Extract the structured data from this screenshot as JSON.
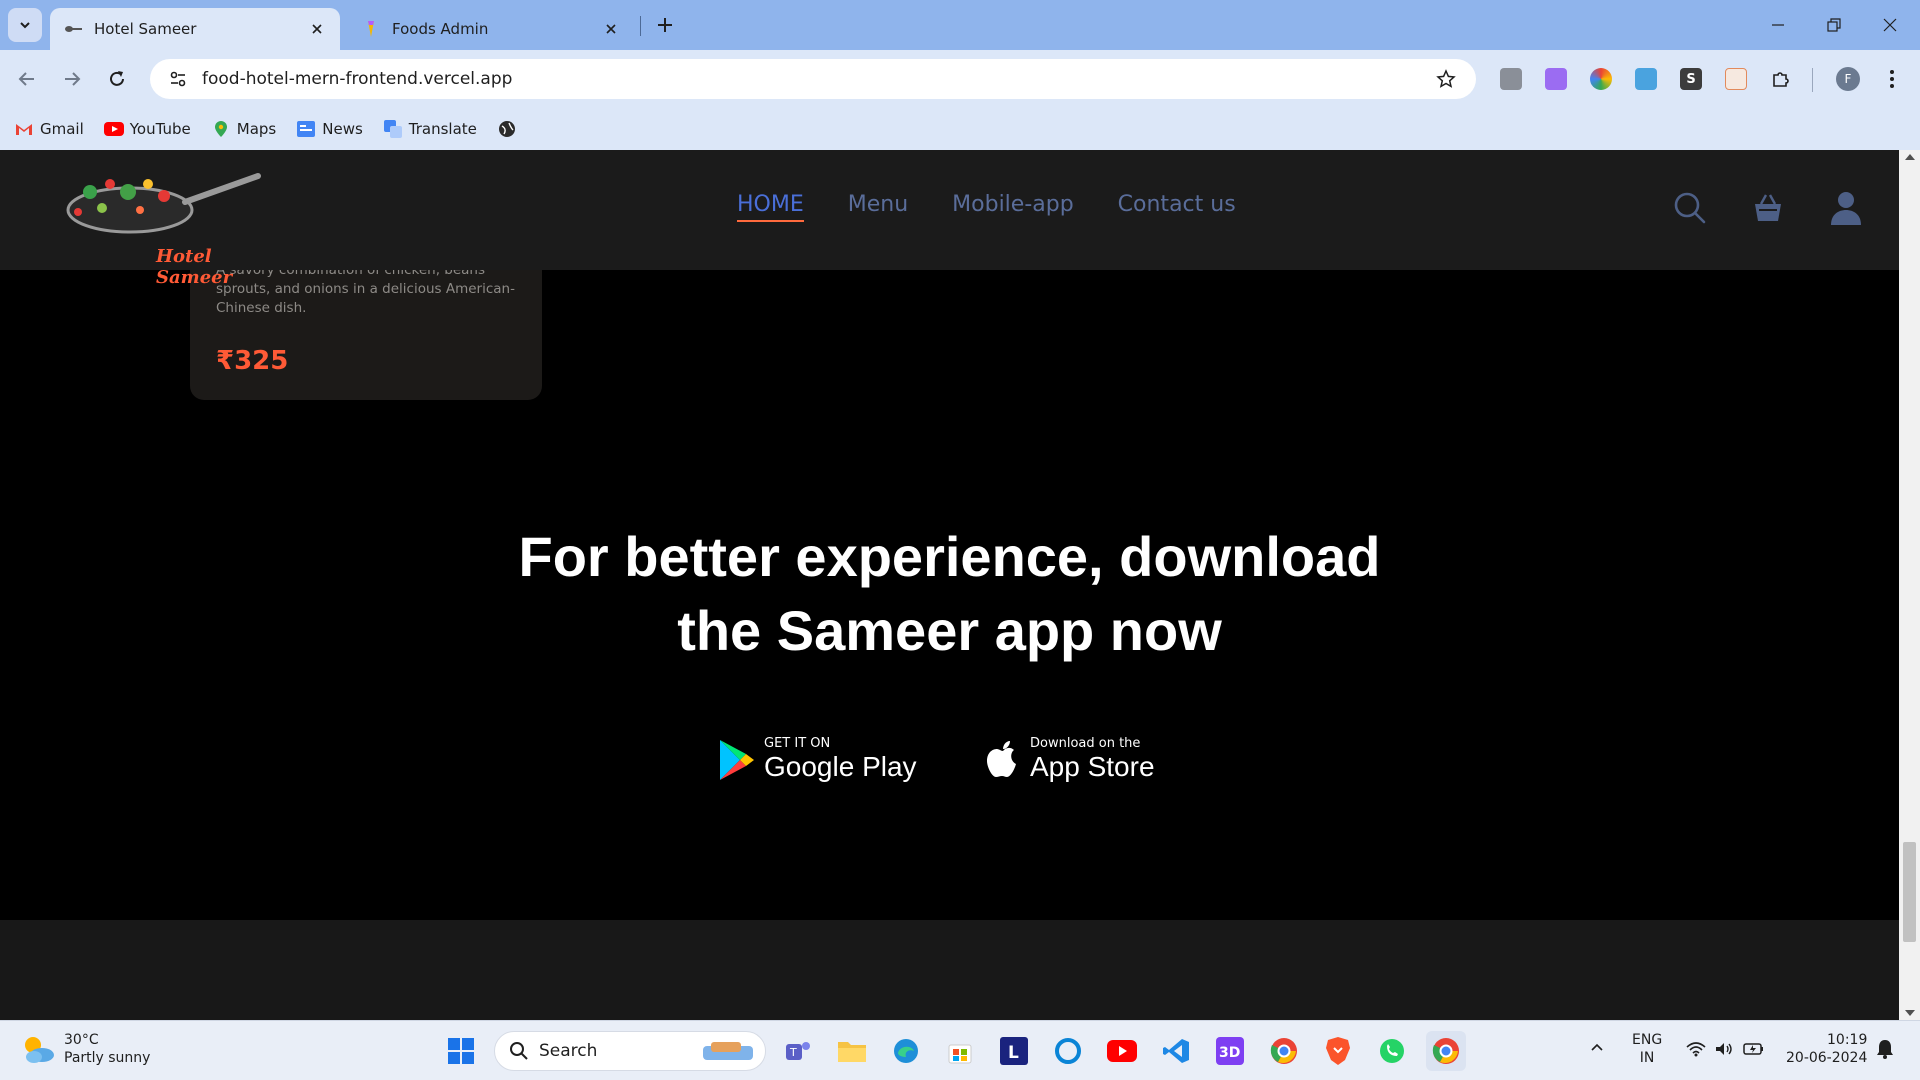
{
  "browser": {
    "tabs": [
      {
        "title": "Hotel Sameer",
        "active": true
      },
      {
        "title": "Foods Admin",
        "active": false
      }
    ],
    "url": "food-hotel-mern-frontend.vercel.app",
    "profile_initial": "F",
    "bookmarks": [
      "Gmail",
      "YouTube",
      "Maps",
      "News",
      "Translate"
    ]
  },
  "site": {
    "logo_text": "Hotel Sameer",
    "nav": [
      "HOME",
      "Menu",
      "Mobile-app",
      "Contact us"
    ],
    "active_nav": "HOME",
    "accent_color": "#ff5a36"
  },
  "food_card": {
    "description_cut": "A savory combination of chicken, beans",
    "description": "sprouts, and onions in a delicious American-Chinese dish.",
    "price": "₹325"
  },
  "download": {
    "headline_line1": "For better experience, download",
    "headline_line2": "the Sameer app now",
    "google_play": {
      "small": "GET IT ON",
      "big": "Google Play"
    },
    "app_store": {
      "small": "Download on the",
      "big": "App Store"
    }
  },
  "taskbar": {
    "weather_temp": "30°C",
    "weather_desc": "Partly sunny",
    "search_label": "Search",
    "lang_top": "ENG",
    "lang_bottom": "IN",
    "time": "10:19",
    "date": "20-06-2024"
  }
}
